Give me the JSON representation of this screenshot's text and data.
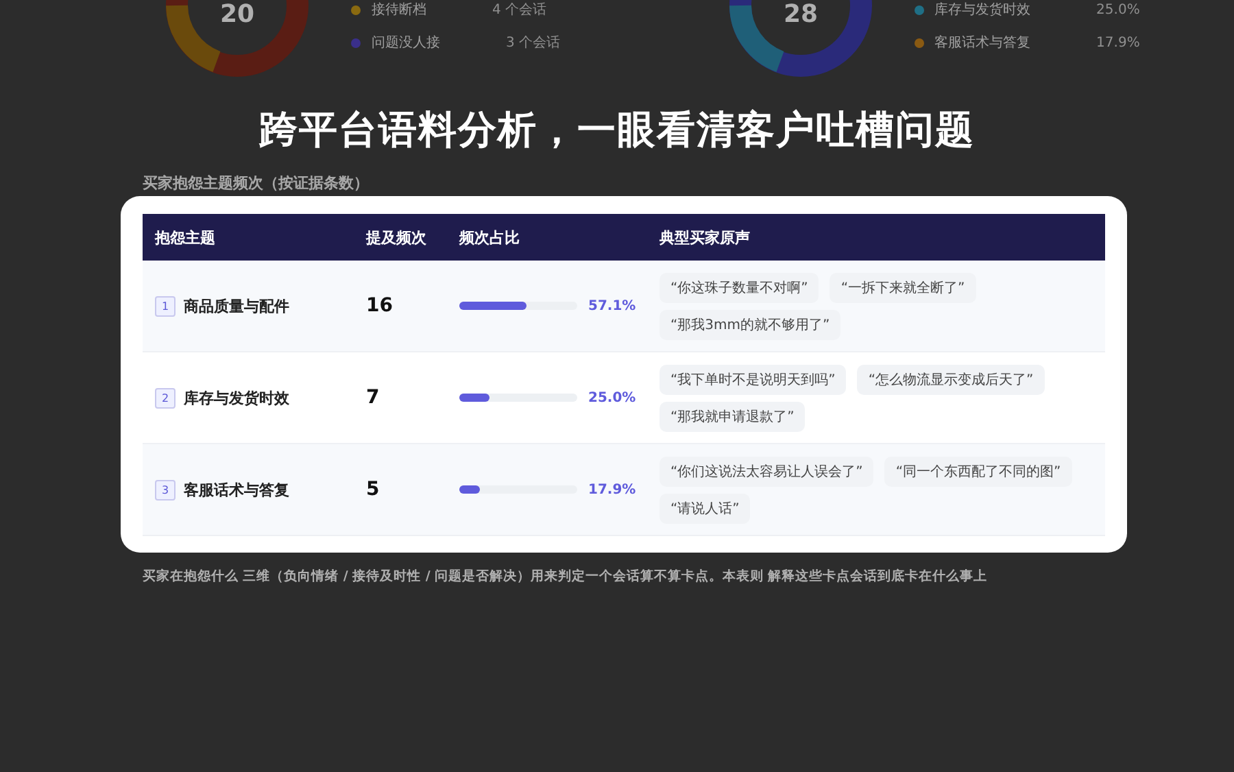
{
  "background_summary": [
    {
      "donut_value": "20",
      "legend": [
        {
          "label": "接待断档",
          "value": "4 个会话",
          "color": "#8a6a10"
        },
        {
          "label": "问题没人接",
          "value": "3 个会话",
          "color": "#3a2f8a"
        }
      ]
    },
    {
      "donut_value": "28",
      "legend": [
        {
          "label": "库存与发货时效",
          "value": "25.0%",
          "color": "#1f6f86"
        },
        {
          "label": "客服话术与答复",
          "value": "17.9%",
          "color": "#8a5a12"
        }
      ]
    }
  ],
  "headline": "跨平台语料分析，一眼看清客户吐槽问题",
  "section_title": "买家抱怨主题频次（按证据条数）",
  "table": {
    "columns": [
      "抱怨主题",
      "提及频次",
      "频次占比",
      "典型买家原声"
    ],
    "rows": [
      {
        "index": "1",
        "topic": "商品质量与配件",
        "count": "16",
        "level": 0.571,
        "share": "57.1%",
        "quotes": [
          "“你这珠子数量不对啊”",
          "“一拆下来就全断了”",
          "“那我3mm的就不够用了”"
        ]
      },
      {
        "index": "2",
        "topic": "库存与发货时效",
        "count": "7",
        "level": 0.25,
        "share": "25.0%",
        "quotes": [
          "“我下单时不是说明天到吗”",
          "“怎么物流显示变成后天了”",
          "“那我就申请退款了”"
        ]
      },
      {
        "index": "3",
        "topic": "客服话术与答复",
        "count": "5",
        "level": 0.179,
        "share": "17.9%",
        "quotes": [
          "“你们这说法太容易让人误会了”",
          "“同一个东西配了不同的图”",
          "“请说人话”"
        ]
      }
    ]
  },
  "note": [
    "买家在抱怨什么",
    "三维（负向情绪 / 接待及时性 / 问题是否解决）用来判定一个会话算不算卡点。本表则",
    "解释这些卡点会话到底卡在什么事上"
  ]
}
